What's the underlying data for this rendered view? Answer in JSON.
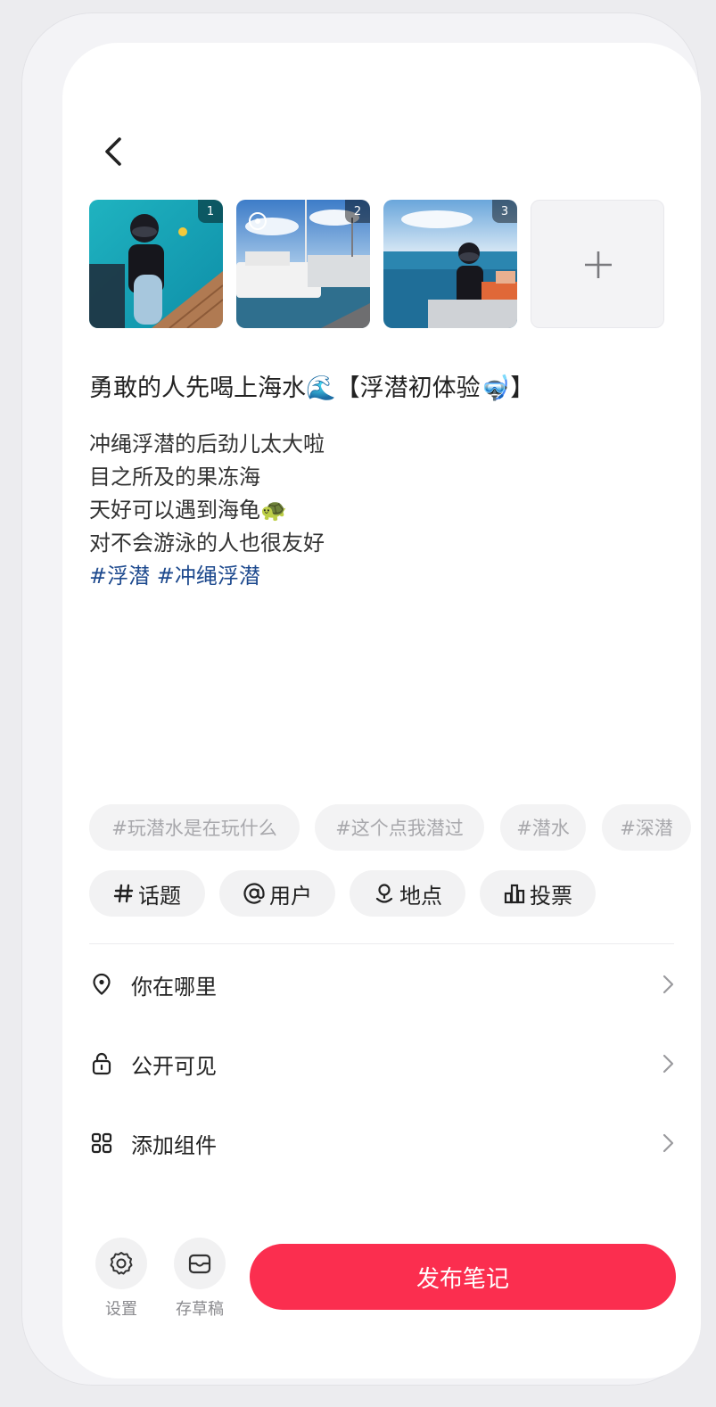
{
  "header": {
    "back_icon": "chevron-left-icon"
  },
  "photos": [
    {
      "index": "1",
      "scene": "snorkeler-on-boat-deck"
    },
    {
      "index": "2",
      "scene": "boats-in-harbor"
    },
    {
      "index": "3",
      "scene": "snorkeler-at-sea"
    }
  ],
  "add_photo_icon": "plus-icon",
  "note": {
    "title": "勇敢的人先喝上海水🌊【浮潜初体验🤿】",
    "lines": [
      "冲绳浮潜的后劲儿太大啦",
      "目之所及的果冻海",
      "天好可以遇到海龟🐢",
      "对不会游泳的人也很友好"
    ],
    "tags": [
      "#浮潜",
      "#冲绳浮潜"
    ]
  },
  "suggested_topics": [
    "#玩潜水是在玩什么",
    "#这个点我潜过",
    "#潜水",
    "#深潜"
  ],
  "insert_chips": [
    {
      "label": "话题",
      "icon": "hash-icon"
    },
    {
      "label": "用户",
      "icon": "at-icon"
    },
    {
      "label": "地点",
      "icon": "location-icon"
    },
    {
      "label": "投票",
      "icon": "vote-icon"
    }
  ],
  "settings_rows": [
    {
      "label": "你在哪里",
      "icon": "location-pin-icon"
    },
    {
      "label": "公开可见",
      "icon": "lock-icon"
    },
    {
      "label": "添加组件",
      "icon": "grid-icon"
    }
  ],
  "footer": {
    "settings_label": "设置",
    "draft_label": "存草稿",
    "publish_label": "发布笔记"
  },
  "colors": {
    "accent": "#fb2e4f",
    "tag": "#1e4a8e",
    "chip_bg": "#f2f2f3"
  }
}
